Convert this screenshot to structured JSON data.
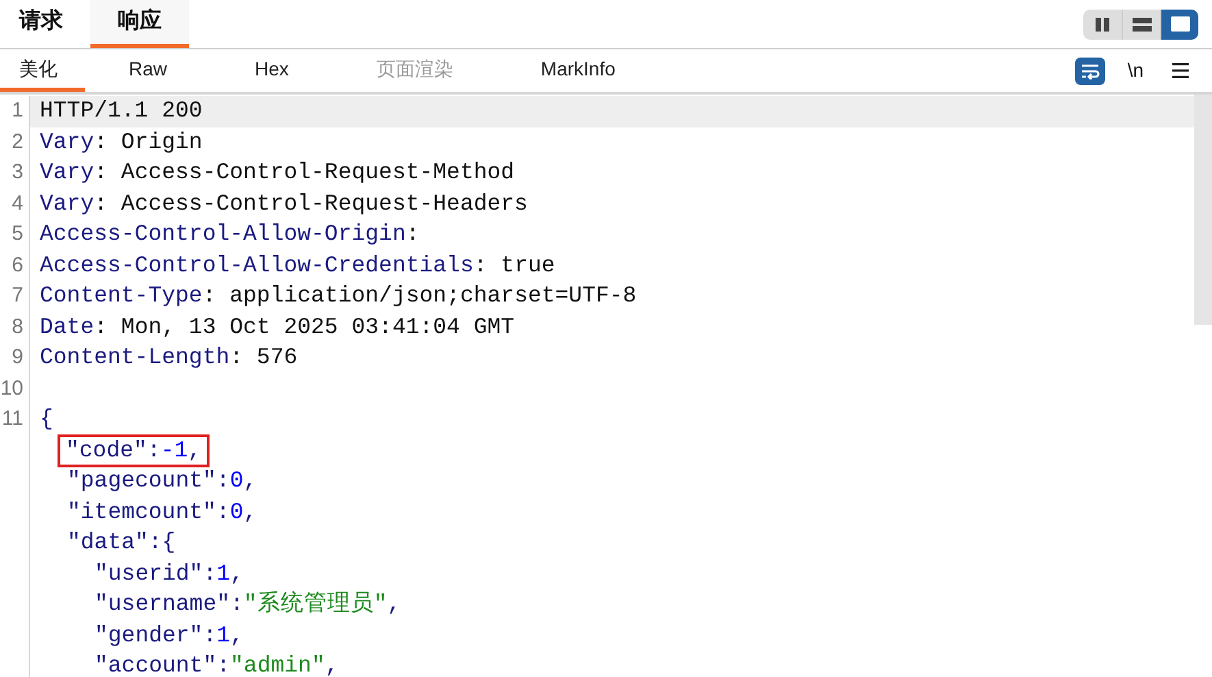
{
  "top_tabs": [
    {
      "label": "请求",
      "selected": false
    },
    {
      "label": "响应",
      "selected": true
    }
  ],
  "view_modes": [
    {
      "kind": "columns",
      "selected": false
    },
    {
      "kind": "rows",
      "selected": false
    },
    {
      "kind": "single",
      "selected": true
    }
  ],
  "sub_tabs": [
    {
      "label": "美化",
      "selected": true,
      "disabled": false
    },
    {
      "label": "Raw",
      "selected": false,
      "disabled": false
    },
    {
      "label": "Hex",
      "selected": false,
      "disabled": false
    },
    {
      "label": "页面渲染",
      "selected": false,
      "disabled": true
    },
    {
      "label": "MarkInfo",
      "selected": false,
      "disabled": false
    }
  ],
  "tools": {
    "wrap_on": true,
    "newline_label": "\\n"
  },
  "lines": [
    {
      "number": "1",
      "current": true,
      "boxed": false,
      "tokens": [
        {
          "kind": "plain",
          "text": "HTTP/1.1 200"
        }
      ]
    },
    {
      "number": "2",
      "current": false,
      "boxed": false,
      "tokens": [
        {
          "kind": "key",
          "text": "Vary"
        },
        {
          "kind": "plain",
          "text": ": Origin"
        }
      ]
    },
    {
      "number": "3",
      "current": false,
      "boxed": false,
      "tokens": [
        {
          "kind": "key",
          "text": "Vary"
        },
        {
          "kind": "plain",
          "text": ": Access-Control-Request-Method"
        }
      ]
    },
    {
      "number": "4",
      "current": false,
      "boxed": false,
      "tokens": [
        {
          "kind": "key",
          "text": "Vary"
        },
        {
          "kind": "plain",
          "text": ": Access-Control-Request-Headers"
        }
      ]
    },
    {
      "number": "5",
      "current": false,
      "boxed": false,
      "tokens": [
        {
          "kind": "key",
          "text": "Access-Control-Allow-Origin"
        },
        {
          "kind": "plain",
          "text": ":"
        }
      ]
    },
    {
      "number": "6",
      "current": false,
      "boxed": false,
      "tokens": [
        {
          "kind": "key",
          "text": "Access-Control-Allow-Credentials"
        },
        {
          "kind": "plain",
          "text": ": true"
        }
      ]
    },
    {
      "number": "7",
      "current": false,
      "boxed": false,
      "tokens": [
        {
          "kind": "key",
          "text": "Content-Type"
        },
        {
          "kind": "plain",
          "text": ": application/json;charset=UTF-8"
        }
      ]
    },
    {
      "number": "8",
      "current": false,
      "boxed": false,
      "tokens": [
        {
          "kind": "key",
          "text": "Date"
        },
        {
          "kind": "plain",
          "text": ": Mon, 13 Oct 2025 03:41:04 GMT"
        }
      ]
    },
    {
      "number": "9",
      "current": false,
      "boxed": false,
      "tokens": [
        {
          "kind": "key",
          "text": "Content-Length"
        },
        {
          "kind": "plain",
          "text": ": 576"
        }
      ]
    },
    {
      "number": "10",
      "current": false
    },
    {
      "number": "11",
      "current": false,
      "boxed": false,
      "tokens": [
        {
          "kind": "key",
          "text": "{"
        }
      ],
      "children": [
        {
          "current": false,
          "boxed": true,
          "tokens": [
            {
              "kind": "key",
              "text": "\"code\":"
            },
            {
              "kind": "number",
              "text": "-1"
            },
            {
              "kind": "key",
              "text": ","
            }
          ]
        },
        {
          "current": false,
          "boxed": false,
          "tokens": [
            {
              "kind": "key",
              "text": "\"pagecount\":"
            },
            {
              "kind": "number",
              "text": "0"
            },
            {
              "kind": "key",
              "text": ","
            }
          ]
        },
        {
          "current": false,
          "boxed": false,
          "tokens": [
            {
              "kind": "key",
              "text": "\"itemcount\":"
            },
            {
              "kind": "number",
              "text": "0"
            },
            {
              "kind": "key",
              "text": ","
            }
          ]
        },
        {
          "current": false,
          "boxed": false,
          "tokens": [
            {
              "kind": "key",
              "text": "\"data\":{"
            }
          ],
          "children": [
            {
              "current": false,
              "boxed": false,
              "tokens": [
                {
                  "kind": "key",
                  "text": "\"userid\":"
                },
                {
                  "kind": "number",
                  "text": "1"
                },
                {
                  "kind": "key",
                  "text": ","
                }
              ]
            },
            {
              "current": false,
              "boxed": false,
              "tokens": [
                {
                  "kind": "key",
                  "text": "\"username\":"
                },
                {
                  "kind": "string",
                  "text": "\"系统管理员\""
                },
                {
                  "kind": "key",
                  "text": ","
                }
              ]
            },
            {
              "current": false,
              "boxed": false,
              "tokens": [
                {
                  "kind": "key",
                  "text": "\"gender\":"
                },
                {
                  "kind": "number",
                  "text": "1"
                },
                {
                  "kind": "key",
                  "text": ","
                }
              ]
            },
            {
              "current": false,
              "boxed": false,
              "tokens": [
                {
                  "kind": "key",
                  "text": "\"account\":"
                },
                {
                  "kind": "string",
                  "text": "\"admin\""
                },
                {
                  "kind": "key",
                  "text": ","
                }
              ]
            }
          ]
        }
      ]
    }
  ]
}
